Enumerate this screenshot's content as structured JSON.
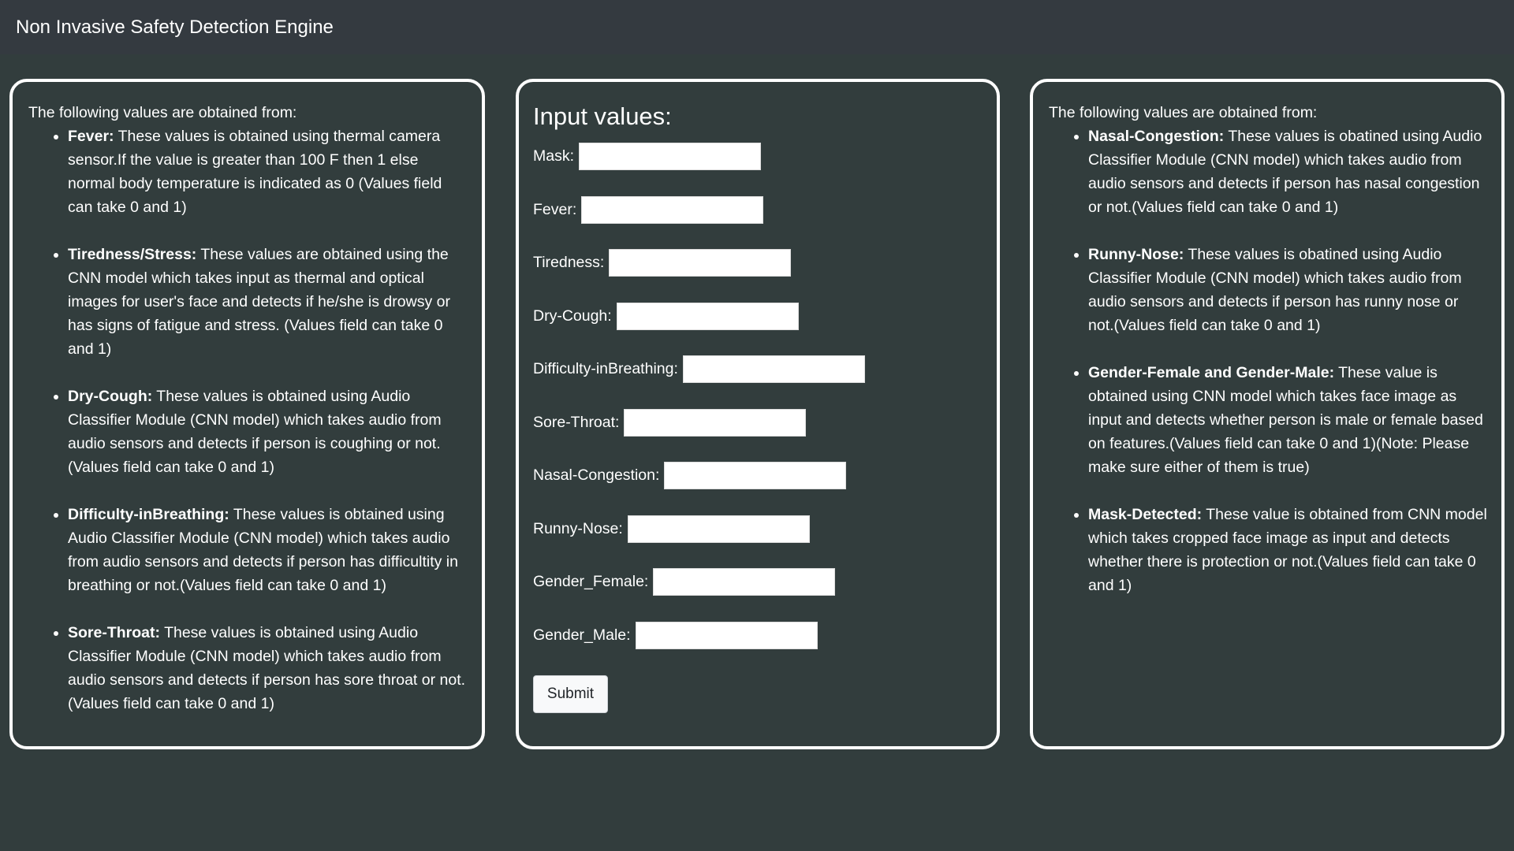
{
  "navbar": {
    "title": "Non Invasive Safety Detection Engine"
  },
  "left_panel": {
    "intro": "The following values are obtained from:",
    "items": [
      {
        "term": "Fever:",
        "text": " These values is obtained using thermal camera sensor.If the value is greater than 100 F then 1 else normal body temperature is indicated as 0 (Values field can take 0 and 1)"
      },
      {
        "term": "Tiredness/Stress:",
        "text": " These values are obtained using the CNN model which takes input as thermal and optical images for user's face and detects if he/she is drowsy or has signs of fatigue and stress. (Values field can take 0 and 1)"
      },
      {
        "term": "Dry-Cough:",
        "text": " These values is obtained using Audio Classifier Module (CNN model) which takes audio from audio sensors and detects if person is coughing or not.(Values field can take 0 and 1)"
      },
      {
        "term": "Difficulty-inBreathing:",
        "text": " These values is obtained using Audio Classifier Module (CNN model) which takes audio from audio sensors and detects if person has difficultity in breathing or not.(Values field can take 0 and 1)"
      },
      {
        "term": "Sore-Throat:",
        "text": " These values is obtained using Audio Classifier Module (CNN model) which takes audio from audio sensors and detects if person has sore throat or not.(Values field can take 0 and 1)"
      }
    ]
  },
  "form": {
    "title": "Input values:",
    "fields": {
      "mask": {
        "label": "Mask:",
        "value": ""
      },
      "fever": {
        "label": "Fever:",
        "value": ""
      },
      "tiredness": {
        "label": "Tiredness:",
        "value": ""
      },
      "dry_cough": {
        "label": "Dry-Cough:",
        "value": ""
      },
      "difficulty_breathing": {
        "label": "Difficulty-inBreathing:",
        "value": ""
      },
      "sore_throat": {
        "label": "Sore-Throat:",
        "value": ""
      },
      "nasal_congestion": {
        "label": "Nasal-Congestion:",
        "value": ""
      },
      "runny_nose": {
        "label": "Runny-Nose:",
        "value": ""
      },
      "gender_female": {
        "label": "Gender_Female:",
        "value": ""
      },
      "gender_male": {
        "label": "Gender_Male:",
        "value": ""
      }
    },
    "submit_label": "Submit"
  },
  "right_panel": {
    "intro": "The following values are obtained from:",
    "items": [
      {
        "term": "Nasal-Congestion:",
        "text": " These values is obatined using Audio Classifier Module (CNN model) which takes audio from audio sensors and detects if person has nasal congestion or not.(Values field can take 0 and 1)"
      },
      {
        "term": "Runny-Nose:",
        "text": " These values is obatined using Audio Classifier Module (CNN model) which takes audio from audio sensors and detects if person has runny nose or not.(Values field can take 0 and 1)"
      },
      {
        "term": "Gender-Female and Gender-Male:",
        "text": " These value is obtained using CNN model which takes face image as input and detects whether person is male or female based on features.(Values field can take 0 and 1)(Note: Please make sure either of them is true)"
      },
      {
        "term": "Mask-Detected:",
        "text": " These value is obtained from CNN model which takes cropped face image as input and detects whether there is protection or not.(Values field can take 0 and 1)"
      }
    ]
  },
  "colors": {
    "background": "#323d3d",
    "navbar": "#343a40",
    "panel_border": "#ffffff",
    "text": "#ffffff"
  }
}
